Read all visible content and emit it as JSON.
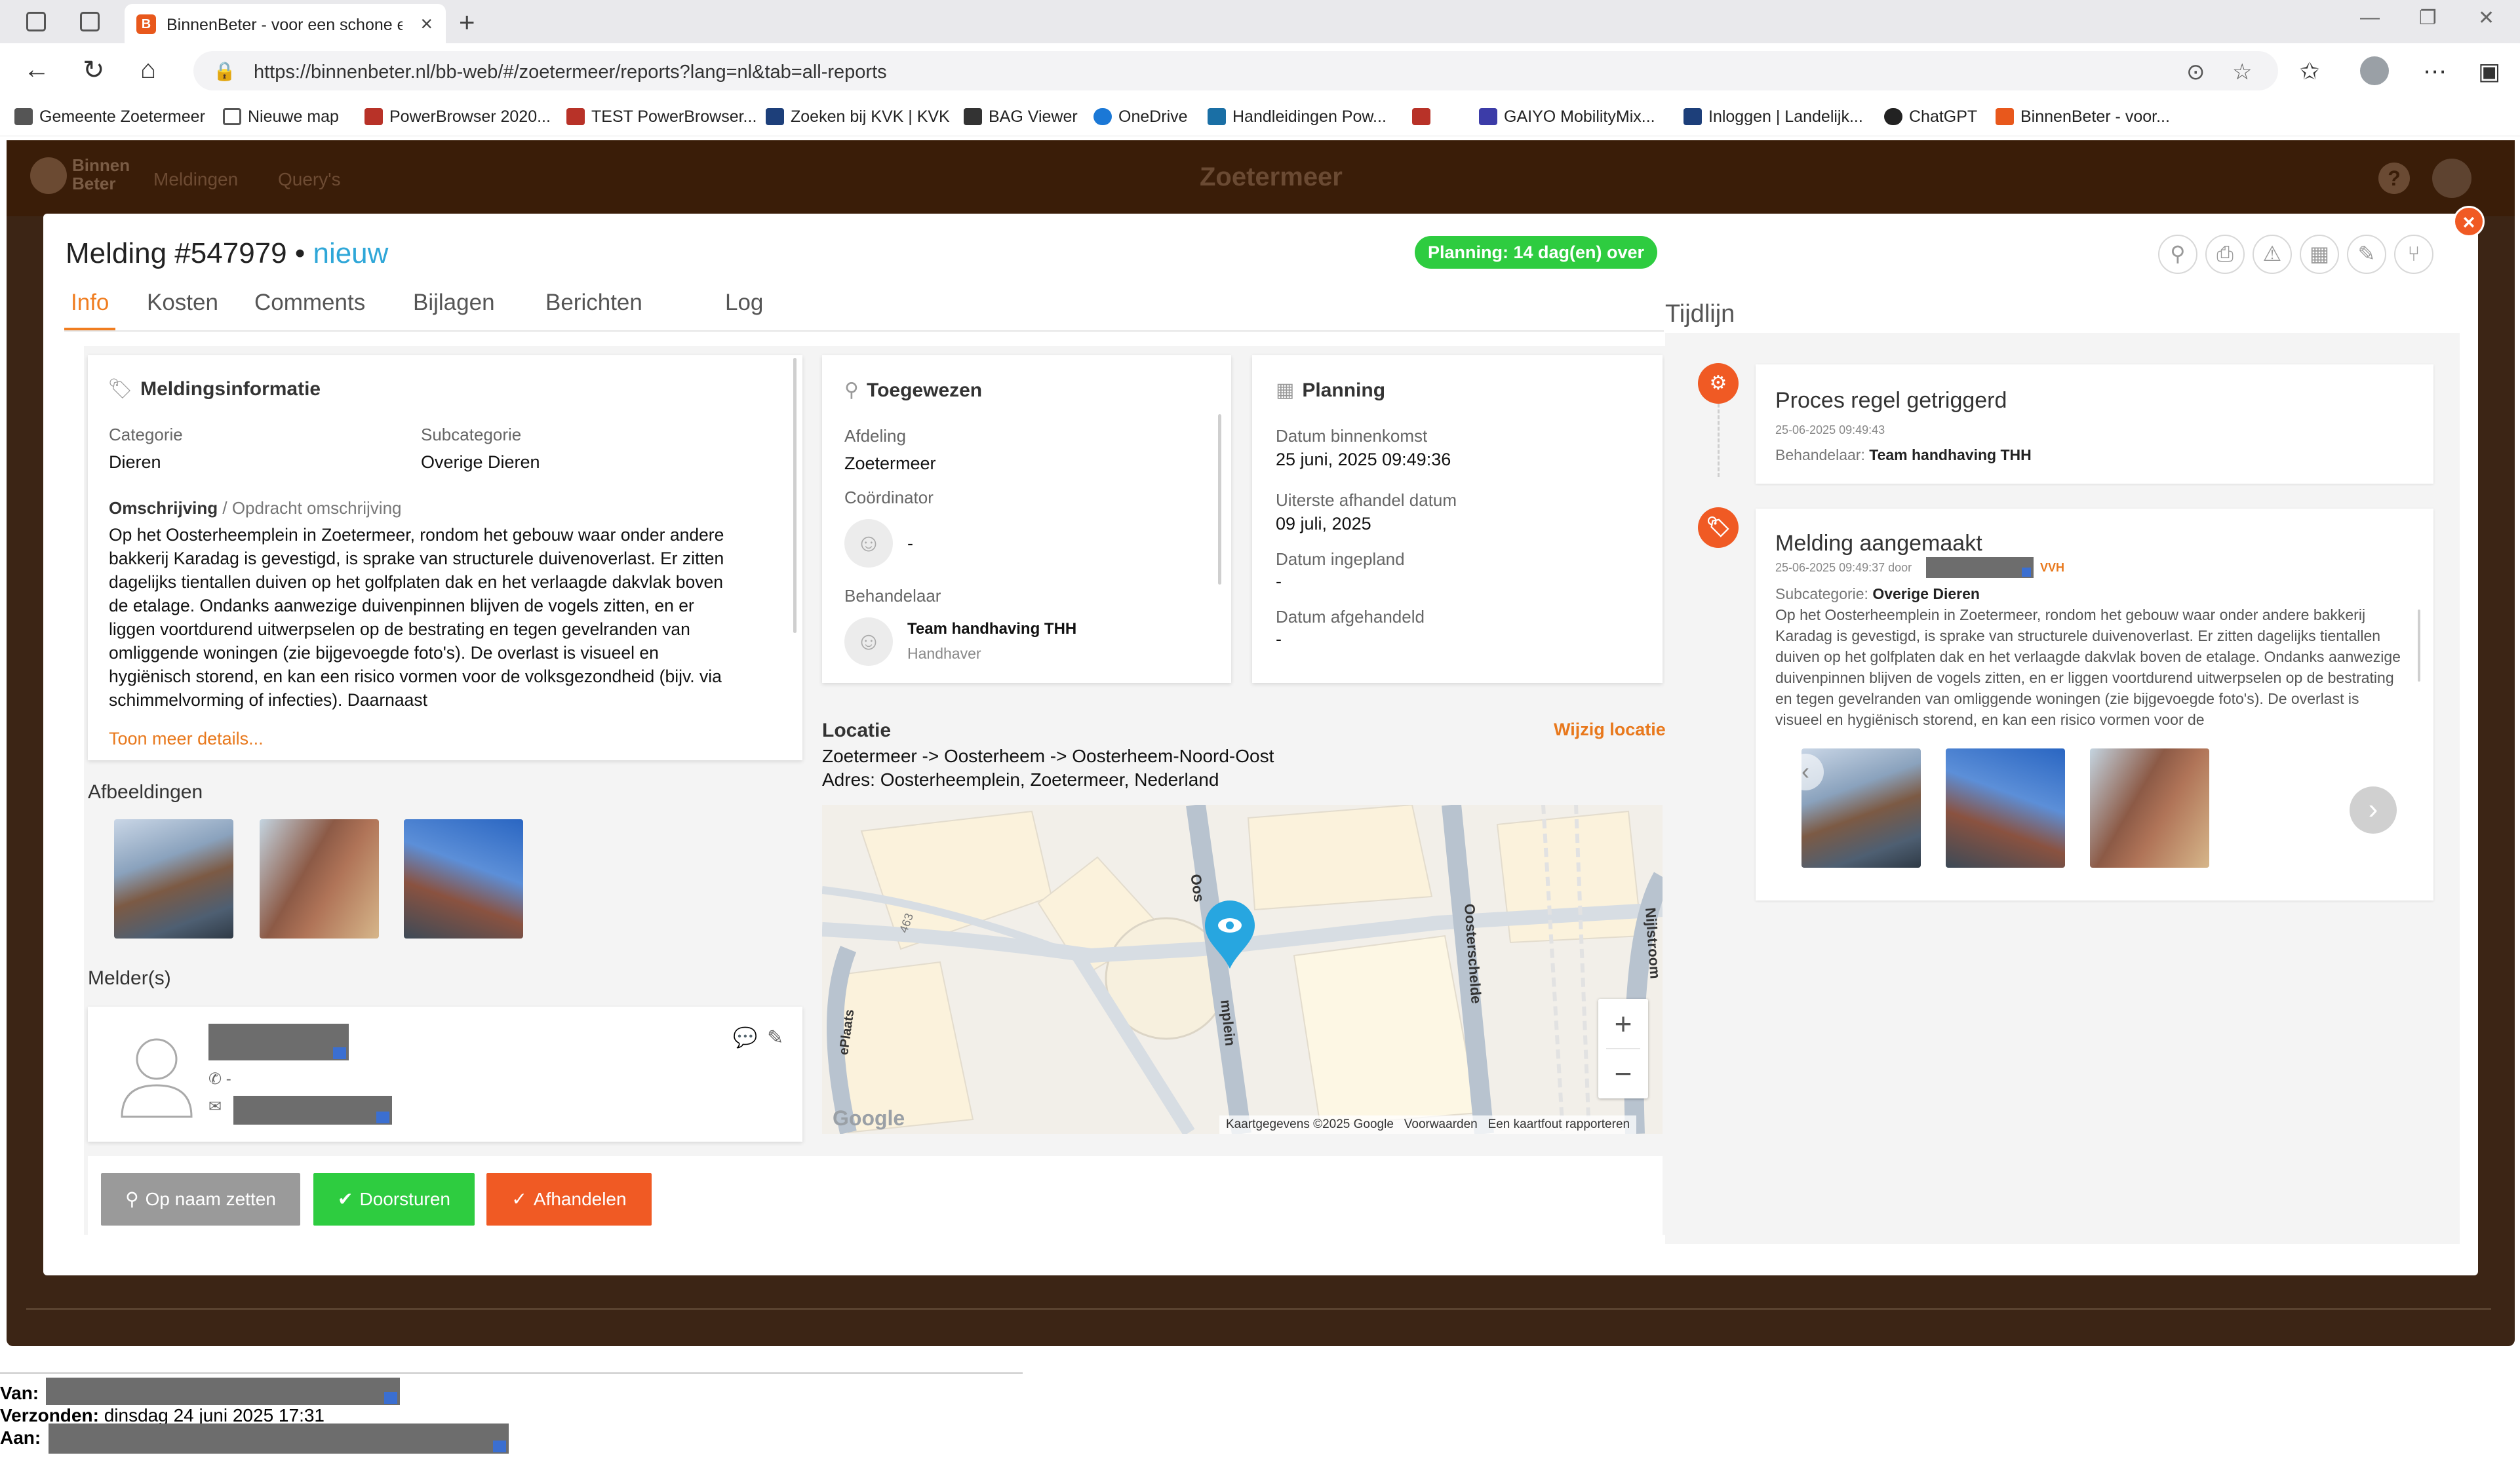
{
  "browser": {
    "tab_title": "BinnenBeter - voor een schone en",
    "url": "https://binnenbeter.nl/bb-web/#/zoetermeer/reports?lang=nl&tab=all-reports",
    "bookmarks": [
      "Gemeente Zoetermeer",
      "Nieuwe map",
      "PowerBrowser 2020...",
      "TEST PowerBrowser...",
      "Zoeken bij KVK | KVK",
      "BAG Viewer",
      "OneDrive",
      "Handleidingen Pow...",
      "GAIYO MobilityMix...",
      "Inloggen | Landelijk...",
      "ChatGPT",
      "BinnenBeter - voor..."
    ]
  },
  "app": {
    "logo_line1": "Binnen",
    "logo_line2": "Beter",
    "nav": [
      "Meldingen",
      "Query's"
    ],
    "city": "Zoetermeer",
    "help": "?"
  },
  "modal": {
    "title": "Melding #547979 • ",
    "status": "nieuw",
    "planning_badge": "Planning: 14 dag(en) over",
    "close": "×",
    "tabs": [
      "Info",
      "Kosten",
      "Comments",
      "Bijlagen",
      "Berichten",
      "Log"
    ],
    "melding": {
      "header": "Meldingsinformatie",
      "categorie_label": "Categorie",
      "categorie": "Dieren",
      "subcategorie_label": "Subcategorie",
      "subcategorie": "Overige Dieren",
      "omschrijving_label": "Omschrijving",
      "opdracht_label": "/ Opdracht omschrijving",
      "omschrijving": "Op het Oosterheemplein in Zoetermeer, rondom het gebouw waar onder andere bakkerij Karadag is gevestigd, is sprake van structurele duivenoverlast. Er zitten dagelijks tientallen duiven op het golfplaten dak en het verlaagde dakvlak boven de etalage. Ondanks aanwezige duivenpinnen blijven de vogels zitten, en er liggen voortdurend uitwerpselen op de bestrating en tegen gevelranden van omliggende woningen (zie bijgevoegde foto's). De overlast is visueel en hygiënisch storend, en kan een risico vormen voor de volksgezondheid (bijv. via schimmelvorming of infecties). Daarnaast",
      "more": "Toon meer details..."
    },
    "afbeeldingen_header": "Afbeeldingen",
    "melders_header": "Melder(s)",
    "melder": {
      "phone": "-"
    },
    "toegewezen": {
      "header": "Toegewezen",
      "afdeling_label": "Afdeling",
      "afdeling": "Zoetermeer",
      "coordinator_label": "Coördinator",
      "coordinator": "-",
      "behandelaar_label": "Behandelaar",
      "behandelaar": "Team handhaving THH",
      "behandelaar_role": "Handhaver"
    },
    "planning": {
      "header": "Planning",
      "binnenkomst_label": "Datum binnenkomst",
      "binnenkomst": "25 juni, 2025 09:49:36",
      "uiterste_label": "Uiterste afhandel datum",
      "uiterste": "09 juli, 2025",
      "ingepland_label": "Datum ingepland",
      "ingepland": "-",
      "afgehandeld_label": "Datum afgehandeld",
      "afgehandeld": "-"
    },
    "locatie": {
      "header": "Locatie",
      "wijzig": "Wijzig locatie",
      "path": "Zoetermeer -> Oosterheem -> Oosterheem-Noord-Oost",
      "adres": "Adres: Oosterheemplein, Zoetermeer, Nederland"
    },
    "map": {
      "street1": "Oosterheemplein",
      "street1_top": "Oos",
      "street1_bottom": "mplein",
      "street2": "Oosterschelde",
      "street3": "Nijlstroom",
      "street4": "ePlaats",
      "number": "463",
      "zoom_in": "+",
      "zoom_out": "−",
      "logo": "Google",
      "attribution": "Kaartgegevens ©2025 Google",
      "terms": "Voorwaarden",
      "report": "Een kaartfout rapporteren"
    },
    "buttons": {
      "op_naam": "Op naam zetten",
      "doorsturen": "Doorsturen",
      "afhandelen": "Afhandelen"
    },
    "tijdlijn": {
      "header": "Tijdlijn",
      "item1": {
        "title": "Proces regel getriggerd",
        "time": "25-06-2025 09:49:43",
        "behandelaar_label": "Behandelaar:",
        "behandelaar": "Team handhaving THH"
      },
      "item2": {
        "title": "Melding aangemaakt",
        "time": "25-06-2025 09:49:37 door",
        "tag": "VVH",
        "sub_label": "Subcategorie:",
        "sub": "Overige Dieren",
        "desc": "Op het Oosterheemplein in Zoetermeer, rondom het gebouw waar onder andere bakkerij Karadag is gevestigd, is sprake van structurele duivenoverlast. Er zitten dagelijks tientallen duiven op het golfplaten dak en het verlaagde dakvlak boven de etalage. Ondanks aanwezige duivenpinnen blijven de vogels zitten, en er liggen voortdurend uitwerpselen op de bestrating en tegen gevelranden van omliggende woningen (zie bijgevoegde foto's). De overlast is visueel en hygiënisch storend, en kan een risico vormen voor de"
      }
    }
  },
  "email": {
    "van_label": "Van:",
    "verzonden_label": "Verzonden:",
    "verzonden": "dinsdag 24 juni 2025 17:31",
    "aan_label": "Aan:"
  },
  "colors": {
    "accent": "#f07d20",
    "status_blue": "#2fa7d8",
    "green": "#2ecc40",
    "orange_button": "#f05a24",
    "grey_button": "#9a9a9a"
  }
}
